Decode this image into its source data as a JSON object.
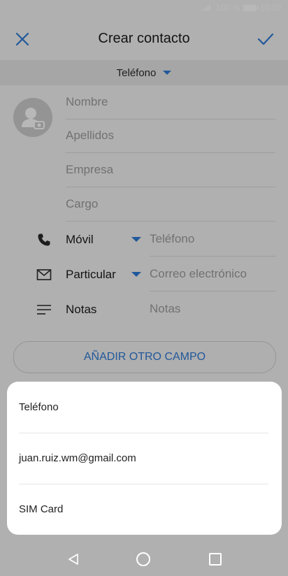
{
  "status_bar": {
    "battery_percent": "100 %",
    "time": "10:00"
  },
  "header": {
    "title": "Crear contacto"
  },
  "account": {
    "label": "Teléfono"
  },
  "fields": {
    "first_name": "Nombre",
    "last_name": "Apellidos",
    "company": "Empresa",
    "job_title": "Cargo"
  },
  "phone": {
    "type": "Móvil",
    "placeholder": "Teléfono"
  },
  "email": {
    "type": "Particular",
    "placeholder": "Correo electrónico"
  },
  "notes": {
    "label": "Notas",
    "placeholder": "Notas"
  },
  "add_field_button": "AÑADIR OTRO CAMPO",
  "save_to_sheet": {
    "options": [
      "Teléfono",
      "juan.ruiz.wm@gmail.com",
      "SIM Card"
    ]
  },
  "colors": {
    "accent": "#2f7ad6",
    "scrim": "rgba(0,0,0,0.28)"
  },
  "icons": [
    "signal-icon",
    "battery-icon",
    "close-icon",
    "check-icon",
    "chevron-down-icon",
    "add-photo-icon",
    "phone-icon",
    "mail-icon",
    "notes-icon",
    "back-icon",
    "home-icon",
    "recent-apps-icon"
  ]
}
